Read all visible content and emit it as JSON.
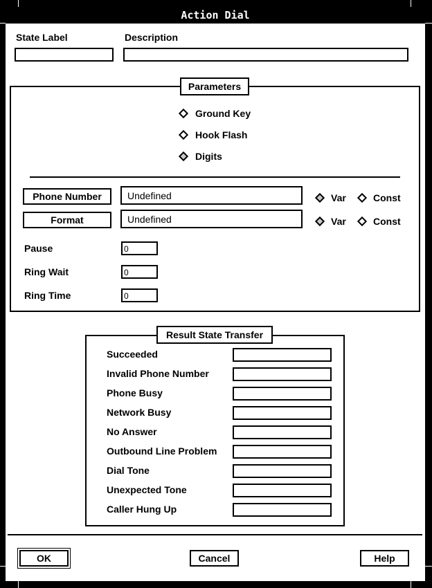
{
  "window": {
    "title": "Action Dial"
  },
  "header": {
    "state_label": {
      "label": "State Label",
      "value": ""
    },
    "description": {
      "label": "Description",
      "value": ""
    }
  },
  "parameters": {
    "title": "Parameters",
    "modes": [
      {
        "label": "Ground Key",
        "selected": false
      },
      {
        "label": "Hook Flash",
        "selected": false
      },
      {
        "label": "Digits",
        "selected": true
      }
    ],
    "phone_number": {
      "button_label": "Phone Number",
      "value": "Undefined",
      "var_label": "Var",
      "const_label": "Const",
      "selected": "Var"
    },
    "format": {
      "button_label": "Format",
      "value": "Undefined",
      "var_label": "Var",
      "const_label": "Const",
      "selected": "Var"
    },
    "timings": [
      {
        "label": "Pause",
        "value": "0"
      },
      {
        "label": "Ring Wait",
        "value": "0"
      },
      {
        "label": "Ring Time",
        "value": "0"
      }
    ]
  },
  "result_state_transfer": {
    "title": "Result State Transfer",
    "rows": [
      {
        "label": "Succeeded",
        "value": ""
      },
      {
        "label": "Invalid Phone Number",
        "value": ""
      },
      {
        "label": "Phone Busy",
        "value": ""
      },
      {
        "label": "Network Busy",
        "value": ""
      },
      {
        "label": "No Answer",
        "value": ""
      },
      {
        "label": "Outbound Line Problem",
        "value": ""
      },
      {
        "label": "Dial Tone",
        "value": ""
      },
      {
        "label": "Unexpected Tone",
        "value": ""
      },
      {
        "label": "Caller Hung Up",
        "value": ""
      }
    ]
  },
  "footer": {
    "ok_label": "OK",
    "cancel_label": "Cancel",
    "help_label": "Help"
  }
}
